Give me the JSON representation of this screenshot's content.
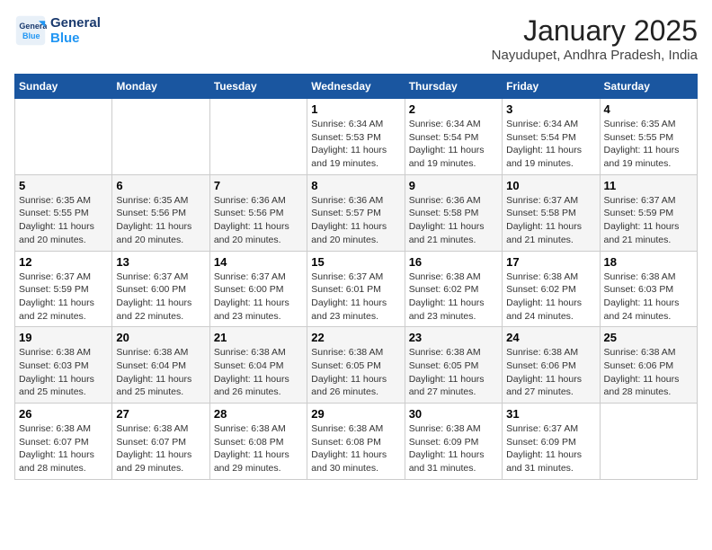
{
  "header": {
    "logo_line1": "General",
    "logo_line2": "Blue",
    "month": "January 2025",
    "location": "Nayudupet, Andhra Pradesh, India"
  },
  "days_of_week": [
    "Sunday",
    "Monday",
    "Tuesday",
    "Wednesday",
    "Thursday",
    "Friday",
    "Saturday"
  ],
  "weeks": [
    [
      {
        "day": "",
        "info": ""
      },
      {
        "day": "",
        "info": ""
      },
      {
        "day": "",
        "info": ""
      },
      {
        "day": "1",
        "info": "Sunrise: 6:34 AM\nSunset: 5:53 PM\nDaylight: 11 hours and 19 minutes."
      },
      {
        "day": "2",
        "info": "Sunrise: 6:34 AM\nSunset: 5:54 PM\nDaylight: 11 hours and 19 minutes."
      },
      {
        "day": "3",
        "info": "Sunrise: 6:34 AM\nSunset: 5:54 PM\nDaylight: 11 hours and 19 minutes."
      },
      {
        "day": "4",
        "info": "Sunrise: 6:35 AM\nSunset: 5:55 PM\nDaylight: 11 hours and 19 minutes."
      }
    ],
    [
      {
        "day": "5",
        "info": "Sunrise: 6:35 AM\nSunset: 5:55 PM\nDaylight: 11 hours and 20 minutes."
      },
      {
        "day": "6",
        "info": "Sunrise: 6:35 AM\nSunset: 5:56 PM\nDaylight: 11 hours and 20 minutes."
      },
      {
        "day": "7",
        "info": "Sunrise: 6:36 AM\nSunset: 5:56 PM\nDaylight: 11 hours and 20 minutes."
      },
      {
        "day": "8",
        "info": "Sunrise: 6:36 AM\nSunset: 5:57 PM\nDaylight: 11 hours and 20 minutes."
      },
      {
        "day": "9",
        "info": "Sunrise: 6:36 AM\nSunset: 5:58 PM\nDaylight: 11 hours and 21 minutes."
      },
      {
        "day": "10",
        "info": "Sunrise: 6:37 AM\nSunset: 5:58 PM\nDaylight: 11 hours and 21 minutes."
      },
      {
        "day": "11",
        "info": "Sunrise: 6:37 AM\nSunset: 5:59 PM\nDaylight: 11 hours and 21 minutes."
      }
    ],
    [
      {
        "day": "12",
        "info": "Sunrise: 6:37 AM\nSunset: 5:59 PM\nDaylight: 11 hours and 22 minutes."
      },
      {
        "day": "13",
        "info": "Sunrise: 6:37 AM\nSunset: 6:00 PM\nDaylight: 11 hours and 22 minutes."
      },
      {
        "day": "14",
        "info": "Sunrise: 6:37 AM\nSunset: 6:00 PM\nDaylight: 11 hours and 23 minutes."
      },
      {
        "day": "15",
        "info": "Sunrise: 6:37 AM\nSunset: 6:01 PM\nDaylight: 11 hours and 23 minutes."
      },
      {
        "day": "16",
        "info": "Sunrise: 6:38 AM\nSunset: 6:02 PM\nDaylight: 11 hours and 23 minutes."
      },
      {
        "day": "17",
        "info": "Sunrise: 6:38 AM\nSunset: 6:02 PM\nDaylight: 11 hours and 24 minutes."
      },
      {
        "day": "18",
        "info": "Sunrise: 6:38 AM\nSunset: 6:03 PM\nDaylight: 11 hours and 24 minutes."
      }
    ],
    [
      {
        "day": "19",
        "info": "Sunrise: 6:38 AM\nSunset: 6:03 PM\nDaylight: 11 hours and 25 minutes."
      },
      {
        "day": "20",
        "info": "Sunrise: 6:38 AM\nSunset: 6:04 PM\nDaylight: 11 hours and 25 minutes."
      },
      {
        "day": "21",
        "info": "Sunrise: 6:38 AM\nSunset: 6:04 PM\nDaylight: 11 hours and 26 minutes."
      },
      {
        "day": "22",
        "info": "Sunrise: 6:38 AM\nSunset: 6:05 PM\nDaylight: 11 hours and 26 minutes."
      },
      {
        "day": "23",
        "info": "Sunrise: 6:38 AM\nSunset: 6:05 PM\nDaylight: 11 hours and 27 minutes."
      },
      {
        "day": "24",
        "info": "Sunrise: 6:38 AM\nSunset: 6:06 PM\nDaylight: 11 hours and 27 minutes."
      },
      {
        "day": "25",
        "info": "Sunrise: 6:38 AM\nSunset: 6:06 PM\nDaylight: 11 hours and 28 minutes."
      }
    ],
    [
      {
        "day": "26",
        "info": "Sunrise: 6:38 AM\nSunset: 6:07 PM\nDaylight: 11 hours and 28 minutes."
      },
      {
        "day": "27",
        "info": "Sunrise: 6:38 AM\nSunset: 6:07 PM\nDaylight: 11 hours and 29 minutes."
      },
      {
        "day": "28",
        "info": "Sunrise: 6:38 AM\nSunset: 6:08 PM\nDaylight: 11 hours and 29 minutes."
      },
      {
        "day": "29",
        "info": "Sunrise: 6:38 AM\nSunset: 6:08 PM\nDaylight: 11 hours and 30 minutes."
      },
      {
        "day": "30",
        "info": "Sunrise: 6:38 AM\nSunset: 6:09 PM\nDaylight: 11 hours and 31 minutes."
      },
      {
        "day": "31",
        "info": "Sunrise: 6:37 AM\nSunset: 6:09 PM\nDaylight: 11 hours and 31 minutes."
      },
      {
        "day": "",
        "info": ""
      }
    ]
  ]
}
